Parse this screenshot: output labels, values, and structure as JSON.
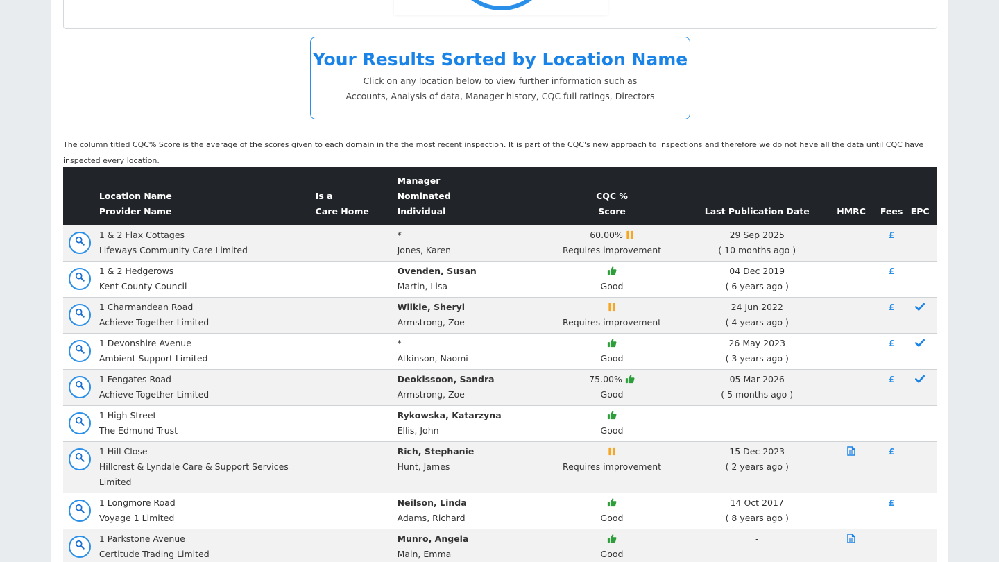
{
  "results_heading": {
    "title": "Your Results Sorted by Location Name",
    "line1": "Click on any location below to view further information such as",
    "line2": "Accounts, Analysis of data, Manager history, CQC full ratings, Directors"
  },
  "note": "The column titled CQC% Score is the average of the scores given to each domain in the the most recent inspection. It is part of the CQC's new approach to inspections and therefore we do not have all the data until CQC have inspected every location.",
  "columns": {
    "loc_line1": "Location Name",
    "loc_line2": "Provider Name",
    "care_line1": "Is a",
    "care_line2": "Care Home",
    "mgr_line1": "Manager",
    "mgr_line2": "Nominated",
    "mgr_line3": "Individual",
    "cqc_line1": "CQC %",
    "cqc_line2": "Score",
    "pub": "Last Publication Date",
    "hmrc": "HMRC",
    "fees": "Fees",
    "epc": "EPC"
  },
  "rows": [
    {
      "location": "1 & 2 Flax Cottages",
      "provider": "Lifeways Community Care Limited",
      "manager": "*",
      "nominated": "Jones, Karen",
      "score": "60.00%",
      "rating_icon": "pause-icon",
      "rating": "Requires improvement",
      "date": "29 Sep 2025",
      "ago": "( 10 months ago )",
      "hmrc": false,
      "fees": "£",
      "epc": false
    },
    {
      "location": "1 & 2 Hedgerows",
      "provider": "Kent County Council",
      "manager": "Ovenden, Susan",
      "nominated": "Martin, Lisa",
      "score": "",
      "rating_icon": "thumbs-up-icon",
      "rating": "Good",
      "date": "04 Dec 2019",
      "ago": "( 6 years ago )",
      "hmrc": false,
      "fees": "£",
      "epc": false
    },
    {
      "location": "1 Charmandean Road",
      "provider": "Achieve Together Limited",
      "manager": "Wilkie, Sheryl",
      "nominated": "Armstrong, Zoe",
      "score": "",
      "rating_icon": "pause-icon",
      "rating": "Requires improvement",
      "date": "24 Jun 2022",
      "ago": "( 4 years ago )",
      "hmrc": false,
      "fees": "£",
      "epc": true
    },
    {
      "location": "1 Devonshire Avenue",
      "provider": "Ambient Support Limited",
      "manager": "*",
      "nominated": "Atkinson, Naomi",
      "score": "",
      "rating_icon": "thumbs-up-icon",
      "rating": "Good",
      "date": "26 May 2023",
      "ago": "( 3 years ago )",
      "hmrc": false,
      "fees": "£",
      "epc": true
    },
    {
      "location": "1 Fengates Road",
      "provider": "Achieve Together Limited",
      "manager": "Deokissoon, Sandra",
      "nominated": "Armstrong, Zoe",
      "score": "75.00%",
      "rating_icon": "thumbs-up-icon",
      "rating": "Good",
      "date": "05 Mar 2026",
      "ago": "( 5 months ago )",
      "hmrc": false,
      "fees": "£",
      "epc": true
    },
    {
      "location": "1 High Street",
      "provider": "The Edmund Trust",
      "manager": "Rykowska, Katarzyna",
      "nominated": "Ellis, John",
      "score": "",
      "rating_icon": "thumbs-up-icon",
      "rating": "Good",
      "date": "-",
      "ago": "",
      "hmrc": false,
      "fees": "",
      "epc": false
    },
    {
      "location": "1 Hill Close",
      "provider": "Hillcrest & Lyndale Care & Support Services Limited",
      "manager": "Rich, Stephanie",
      "nominated": "Hunt, James",
      "score": "",
      "rating_icon": "pause-icon",
      "rating": "Requires improvement",
      "date": "15 Dec 2023",
      "ago": "( 2 years ago )",
      "hmrc": true,
      "fees": "£",
      "epc": false
    },
    {
      "location": "1 Longmore Road",
      "provider": "Voyage 1 Limited",
      "manager": "Neilson, Linda",
      "nominated": "Adams, Richard",
      "score": "",
      "rating_icon": "thumbs-up-icon",
      "rating": "Good",
      "date": "14 Oct 2017",
      "ago": "( 8 years ago )",
      "hmrc": false,
      "fees": "£",
      "epc": false
    },
    {
      "location": "1 Parkstone Avenue",
      "provider": "Certitude Trading Limited",
      "manager": "Munro, Angela",
      "nominated": "Main, Emma",
      "score": "",
      "rating_icon": "thumbs-up-icon",
      "rating": "Good",
      "date": "-",
      "ago": "",
      "hmrc": true,
      "fees": "",
      "epc": false
    }
  ],
  "colors": {
    "accent": "#2a8fe8",
    "good": "#28a745",
    "warning": "#f5a623",
    "header_bg": "#212529"
  }
}
